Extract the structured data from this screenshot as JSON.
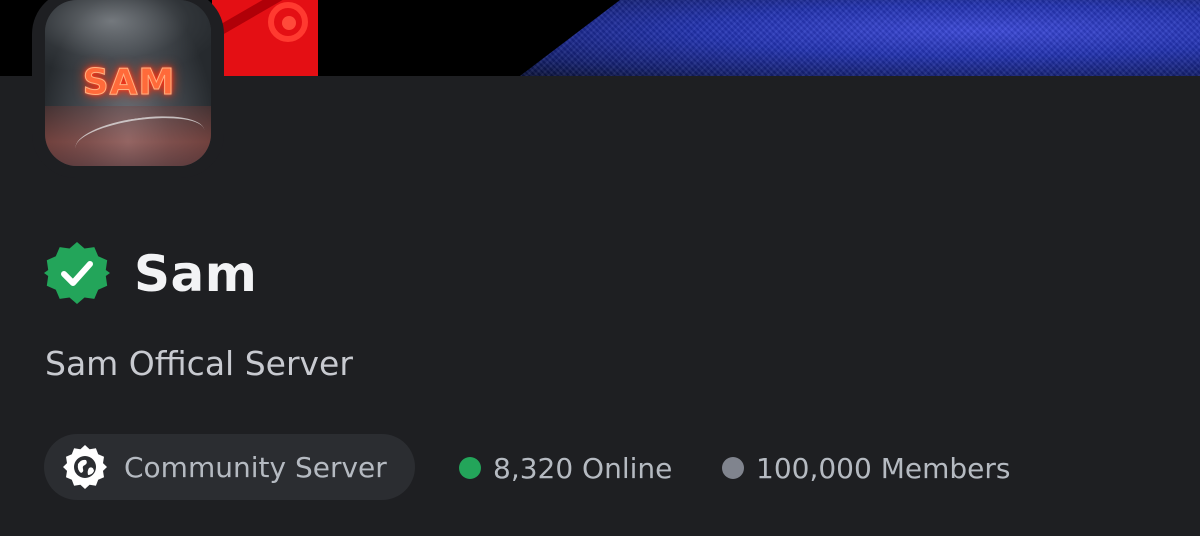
{
  "server": {
    "name": "Sam",
    "description": "Sam Offical Server",
    "avatar_text": "SAM",
    "verified_icon": "verified-badge-icon"
  },
  "tags": {
    "community_label": "Community Server",
    "community_icon": "community-globe-icon"
  },
  "stats": {
    "online": "8,320 Online",
    "members": "100,000 Members"
  },
  "colors": {
    "background": "#1e1f22",
    "pill_background": "#2b2d31",
    "verified_green": "#23a55a",
    "online_dot": "#23a55a",
    "members_dot": "#80848e",
    "title_text": "#f2f3f5",
    "muted_text": "#b5bac1",
    "banner_red": "#e40f14",
    "banner_blue": "#2232b0"
  }
}
